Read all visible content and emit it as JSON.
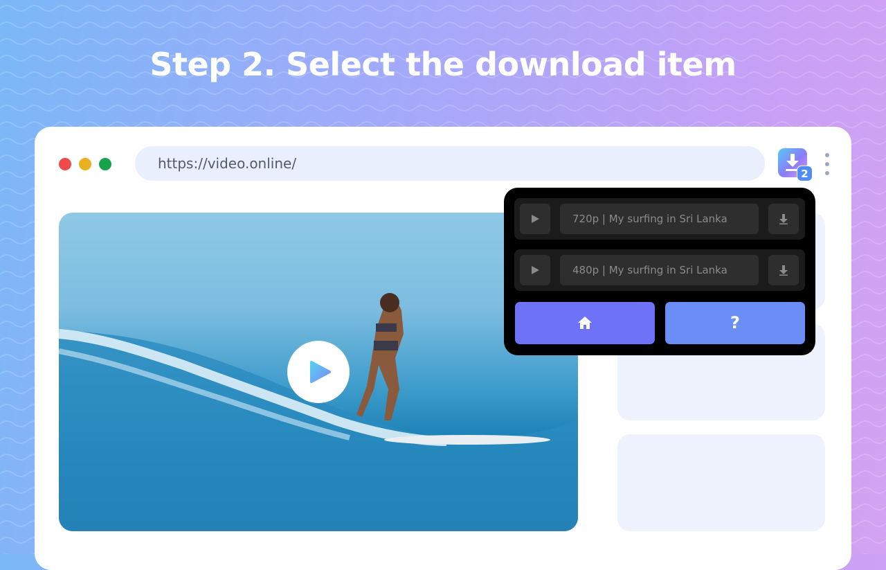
{
  "headline": "Step 2. Select the download item",
  "browser": {
    "url": "https://video.online/",
    "extension": {
      "icon": "download-icon",
      "badge_count": "2"
    },
    "menu_icon": "kebab-menu-icon"
  },
  "video": {
    "play_icon": "play-icon"
  },
  "popup": {
    "items": [
      {
        "label": "720p | My surfing in Sri Lanka",
        "play_icon": "play-icon",
        "download_icon": "download-arrow-icon"
      },
      {
        "label": "480p | My surfing in Sri Lanka",
        "play_icon": "play-icon",
        "download_icon": "download-arrow-icon"
      }
    ],
    "home_icon": "home-icon",
    "help_label": "?"
  },
  "colors": {
    "accent_purple": "#6e72f7",
    "accent_blue": "#6a8df6",
    "popup_bg": "#000000"
  }
}
